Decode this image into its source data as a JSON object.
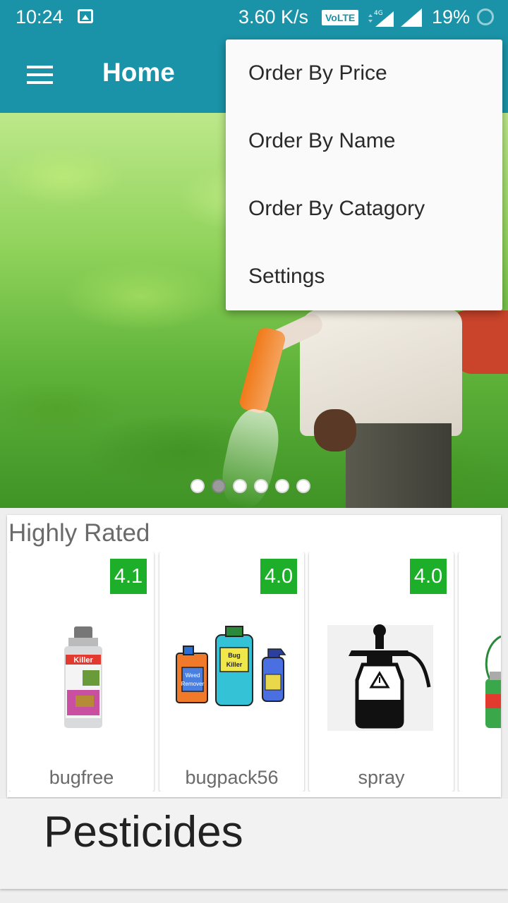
{
  "status_bar": {
    "time": "10:24",
    "speed": "3.60 K/s",
    "volte": "VoLTE",
    "network": "4G",
    "battery": "19%"
  },
  "app_bar": {
    "title": "Home",
    "menu_icon": "hamburger-menu-icon"
  },
  "banner": {
    "slide_count": 6,
    "active_slide": 2
  },
  "highly_rated": {
    "heading": "Highly Rated",
    "products": [
      {
        "name": "bugfree",
        "rating": "4.1"
      },
      {
        "name": "bugpack56",
        "rating": "4.0"
      },
      {
        "name": "spray",
        "rating": "4.0"
      }
    ]
  },
  "category": {
    "label": "Pesticides"
  },
  "overflow_menu": {
    "items": [
      {
        "label": "Order By Price"
      },
      {
        "label": "Order By Name"
      },
      {
        "label": "Order By Catagory"
      },
      {
        "label": "Settings"
      }
    ]
  },
  "colors": {
    "primary": "#1a93a8",
    "rating_badge": "#1dae2a"
  }
}
